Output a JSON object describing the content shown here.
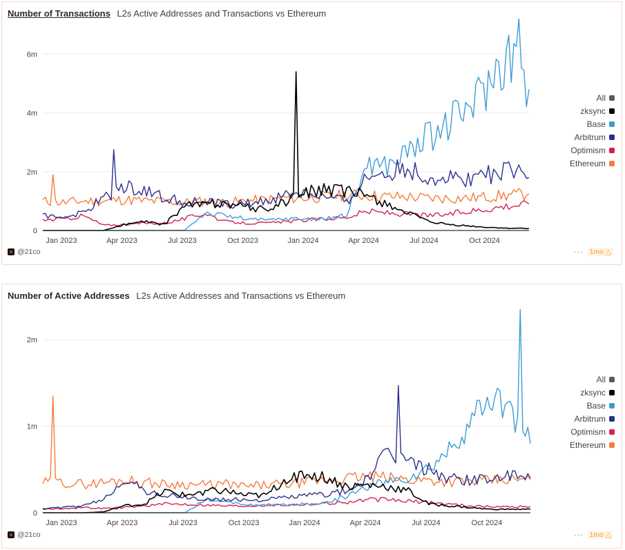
{
  "panels": [
    {
      "id": "tx",
      "title": "Number of Transactions",
      "subtitle": "L2s Active Addresses and Transactions vs Ethereum",
      "brand": "@21co",
      "more_label": "···",
      "freshness": "1mo",
      "freshness_icon": "warning-triangle-icon"
    },
    {
      "id": "addr",
      "title": "Number of Active Addresses",
      "subtitle": "L2s Active Addresses and Transactions vs Ethereum",
      "brand": "@21co",
      "more_label": "···",
      "freshness": "1mo",
      "freshness_icon": "warning-triangle-icon"
    }
  ],
  "legend": [
    {
      "label": "All",
      "color": "#5a5a5a"
    },
    {
      "label": "zksync",
      "color": "#000000"
    },
    {
      "label": "Base",
      "color": "#3e9bd6"
    },
    {
      "label": "Arbitrum",
      "color": "#2b2f8a"
    },
    {
      "label": "Optimism",
      "color": "#d42150"
    },
    {
      "label": "Ethereum",
      "color": "#f47c3c"
    }
  ],
  "chart_data": [
    {
      "type": "line",
      "title": "Number of Transactions",
      "subtitle": "L2s Active Addresses and Transactions vs Ethereum",
      "xlabel": "",
      "ylabel": "",
      "x_range": [
        "2022-12",
        "2024-12"
      ],
      "x_ticks": [
        "Jan 2023",
        "Apr 2023",
        "Jul 2023",
        "Oct 2023",
        "Jan 2024",
        "Apr 2024",
        "Jul 2024",
        "Oct 2024"
      ],
      "y_ticks": [
        "0",
        "2m",
        "4m",
        "6m"
      ],
      "y_tick_values": [
        0,
        2000000,
        4000000,
        6000000
      ],
      "ylim": [
        0,
        7300000
      ],
      "grid": true,
      "legend_position": "right",
      "x": [
        "Dec 2022",
        "Jan 2023",
        "Feb 2023",
        "Mar 2023",
        "Apr 2023",
        "May 2023",
        "Jun 2023",
        "Jul 2023",
        "Aug 2023",
        "Sep 2023",
        "Oct 2023",
        "Nov 2023",
        "Dec 2023",
        "Jan 2024",
        "Feb 2024",
        "Mar 2024",
        "Apr 2024",
        "May 2024",
        "Jun 2024",
        "Jul 2024",
        "Aug 2024",
        "Sep 2024",
        "Oct 2024",
        "Nov 2024",
        "Dec 2024"
      ],
      "series": [
        {
          "name": "zksync",
          "values": [
            0,
            0,
            0,
            0,
            200000,
            300000,
            200000,
            850000,
            900000,
            950000,
            800000,
            700000,
            1000000,
            1300000,
            1400000,
            1300000,
            1200000,
            900000,
            600000,
            300000,
            200000,
            150000,
            100000,
            80000,
            70000
          ],
          "peak": {
            "x": "Dec 2023",
            "value": 5400000
          }
        },
        {
          "name": "Base",
          "values": [
            0,
            0,
            0,
            0,
            0,
            0,
            0,
            10000,
            600000,
            500000,
            400000,
            350000,
            400000,
            400000,
            400000,
            500000,
            2300000,
            2200000,
            2700000,
            3200000,
            3600000,
            4200000,
            5000000,
            6100000,
            4800000
          ],
          "peak": {
            "x": "Nov 2024",
            "value": 7200000
          }
        },
        {
          "name": "Arbitrum",
          "values": [
            500000,
            450000,
            600000,
            1100000,
            1500000,
            1400000,
            1100000,
            1000000,
            950000,
            900000,
            900000,
            1000000,
            1200000,
            1300000,
            1100000,
            1000000,
            1800000,
            2000000,
            2100000,
            1800000,
            1800000,
            1800000,
            1900000,
            2000000,
            1800000
          ],
          "peak": {
            "x": "Mar 2023",
            "value": 2750000
          }
        },
        {
          "name": "Optimism",
          "values": [
            350000,
            400000,
            500000,
            180000,
            200000,
            250000,
            250000,
            400000,
            600000,
            300000,
            250000,
            250000,
            300000,
            350000,
            400000,
            450000,
            650000,
            600000,
            550000,
            500000,
            550000,
            650000,
            750000,
            850000,
            900000
          ]
        },
        {
          "name": "Ethereum",
          "values": [
            1000000,
            950000,
            1000000,
            1000000,
            1050000,
            1000000,
            1000000,
            950000,
            1000000,
            950000,
            1000000,
            1050000,
            1100000,
            1100000,
            1150000,
            1200000,
            1200000,
            1150000,
            1150000,
            1100000,
            1100000,
            1100000,
            1150000,
            1200000,
            1250000
          ],
          "peak": {
            "x": "Dec 2022",
            "value": 1900000
          }
        }
      ]
    },
    {
      "type": "line",
      "title": "Number of Active Addresses",
      "subtitle": "L2s Active Addresses and Transactions vs Ethereum",
      "xlabel": "",
      "ylabel": "",
      "x_range": [
        "2022-12",
        "2024-12"
      ],
      "x_ticks": [
        "Jan 2023",
        "Apr 2023",
        "Jul 2023",
        "Oct 2023",
        "Jan 2024",
        "Apr 2024",
        "Jul 2024",
        "Oct 2024"
      ],
      "y_ticks": [
        "0",
        "1m",
        "2m"
      ],
      "y_tick_values": [
        0,
        1000000,
        2000000
      ],
      "ylim": [
        0,
        2400000
      ],
      "grid": true,
      "legend_position": "right",
      "x": [
        "Dec 2022",
        "Jan 2023",
        "Feb 2023",
        "Mar 2023",
        "Apr 2023",
        "May 2023",
        "Jun 2023",
        "Jul 2023",
        "Aug 2023",
        "Sep 2023",
        "Oct 2023",
        "Nov 2023",
        "Dec 2023",
        "Jan 2024",
        "Feb 2024",
        "Mar 2024",
        "Apr 2024",
        "May 2024",
        "Jun 2024",
        "Jul 2024",
        "Aug 2024",
        "Sep 2024",
        "Oct 2024",
        "Nov 2024",
        "Dec 2024"
      ],
      "series": [
        {
          "name": "zksync",
          "values": [
            0,
            0,
            0,
            10000,
            80000,
            100000,
            250000,
            200000,
            250000,
            250000,
            200000,
            200000,
            400000,
            450000,
            400000,
            300000,
            320000,
            300000,
            250000,
            100000,
            80000,
            60000,
            40000,
            40000,
            40000
          ]
        },
        {
          "name": "Base",
          "values": [
            0,
            0,
            0,
            0,
            0,
            0,
            0,
            0,
            150000,
            120000,
            100000,
            80000,
            90000,
            100000,
            120000,
            200000,
            300000,
            350000,
            400000,
            500000,
            700000,
            1000000,
            1300000,
            1200000,
            800000
          ],
          "peak": {
            "x": "Nov 2024",
            "value": 2350000
          }
        },
        {
          "name": "Arbitrum",
          "values": [
            50000,
            60000,
            80000,
            150000,
            400000,
            250000,
            200000,
            180000,
            150000,
            150000,
            150000,
            150000,
            180000,
            200000,
            220000,
            250000,
            400000,
            700000,
            600000,
            500000,
            400000,
            380000,
            400000,
            420000,
            400000
          ],
          "peak": {
            "x": "May 2024",
            "value": 1470000
          }
        },
        {
          "name": "Optimism",
          "values": [
            40000,
            50000,
            60000,
            50000,
            60000,
            80000,
            100000,
            100000,
            90000,
            80000,
            80000,
            90000,
            90000,
            100000,
            110000,
            120000,
            150000,
            150000,
            130000,
            120000,
            100000,
            80000,
            70000,
            70000,
            70000
          ]
        },
        {
          "name": "Ethereum",
          "values": [
            350000,
            350000,
            330000,
            350000,
            380000,
            350000,
            330000,
            330000,
            320000,
            330000,
            300000,
            320000,
            330000,
            350000,
            380000,
            400000,
            420000,
            400000,
            380000,
            380000,
            360000,
            360000,
            370000,
            380000,
            380000
          ],
          "peak": {
            "x": "Dec 2022",
            "value": 1350000
          }
        }
      ]
    }
  ]
}
